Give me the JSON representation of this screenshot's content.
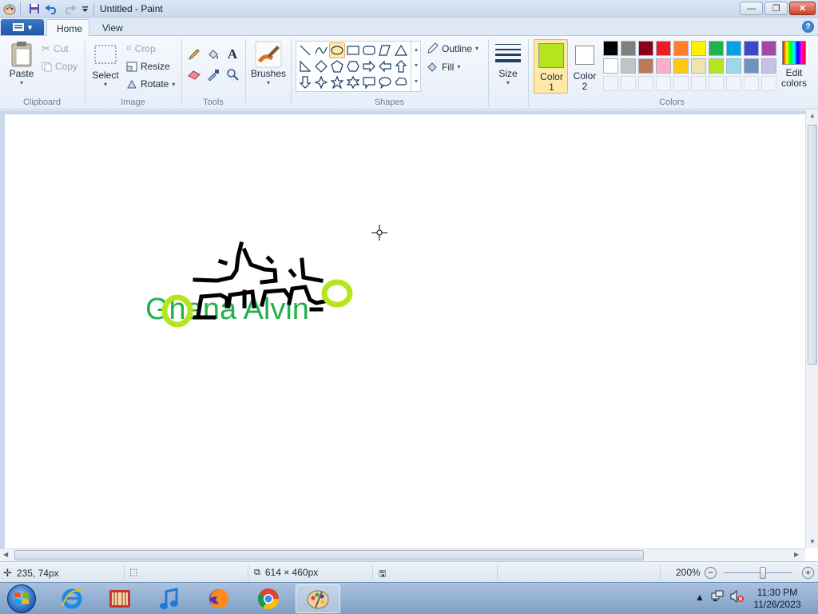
{
  "window": {
    "title": "Untitled - Paint",
    "controls": {
      "minimize": "—",
      "maximize": "❐",
      "close": "✕"
    }
  },
  "quick_access": {
    "icons": [
      "paint-app-icon",
      "save-icon",
      "undo-icon",
      "redo-icon",
      "customize-icon"
    ]
  },
  "tabs": [
    {
      "label": "Home",
      "active": true
    },
    {
      "label": "View",
      "active": false
    }
  ],
  "ribbon": {
    "clipboard": {
      "label": "Clipboard",
      "paste": "Paste",
      "cut": "Cut",
      "copy": "Copy"
    },
    "image": {
      "label": "Image",
      "select": "Select",
      "crop": "Crop",
      "resize": "Resize",
      "rotate": "Rotate"
    },
    "tools": {
      "label": "Tools"
    },
    "brushes": {
      "label": "Brushes"
    },
    "shapes": {
      "label": "Shapes",
      "outline": "Outline",
      "fill": "Fill",
      "selected": "oval"
    },
    "size": {
      "label": "Size"
    },
    "colors": {
      "label": "Colors",
      "color1_label": "Color\n1",
      "color2_label": "Color\n2",
      "color1": "#b5e61d",
      "color2": "#ffffff",
      "edit_colors": "Edit\ncolors",
      "palette_row1": [
        "#000000",
        "#7f7f7f",
        "#880015",
        "#ed1c24",
        "#ff7f27",
        "#fff200",
        "#22b14c",
        "#00a2e8",
        "#3f48cc",
        "#a349a4"
      ],
      "palette_row2": [
        "#ffffff",
        "#c3c3c3",
        "#b97a57",
        "#ffaec9",
        "#ffc90e",
        "#efe4b0",
        "#b5e61d",
        "#99d9ea",
        "#7092be",
        "#c8bfe7"
      ]
    }
  },
  "canvas": {
    "text": "Ghana Alvin",
    "text_color": "#22b14c",
    "stroke_color": "#000000",
    "circle_color": "#b5e61d"
  },
  "status": {
    "cursor_pos": "235, 74px",
    "image_size": "614 × 460px",
    "zoom": "200%"
  },
  "taskbar": {
    "apps": [
      "windows-start-icon",
      "internet-explorer-icon",
      "media-center-icon",
      "itunes-icon",
      "firefox-icon",
      "chrome-icon",
      "paint-icon"
    ],
    "time": "11:30 PM",
    "date": "11/26/2023"
  }
}
